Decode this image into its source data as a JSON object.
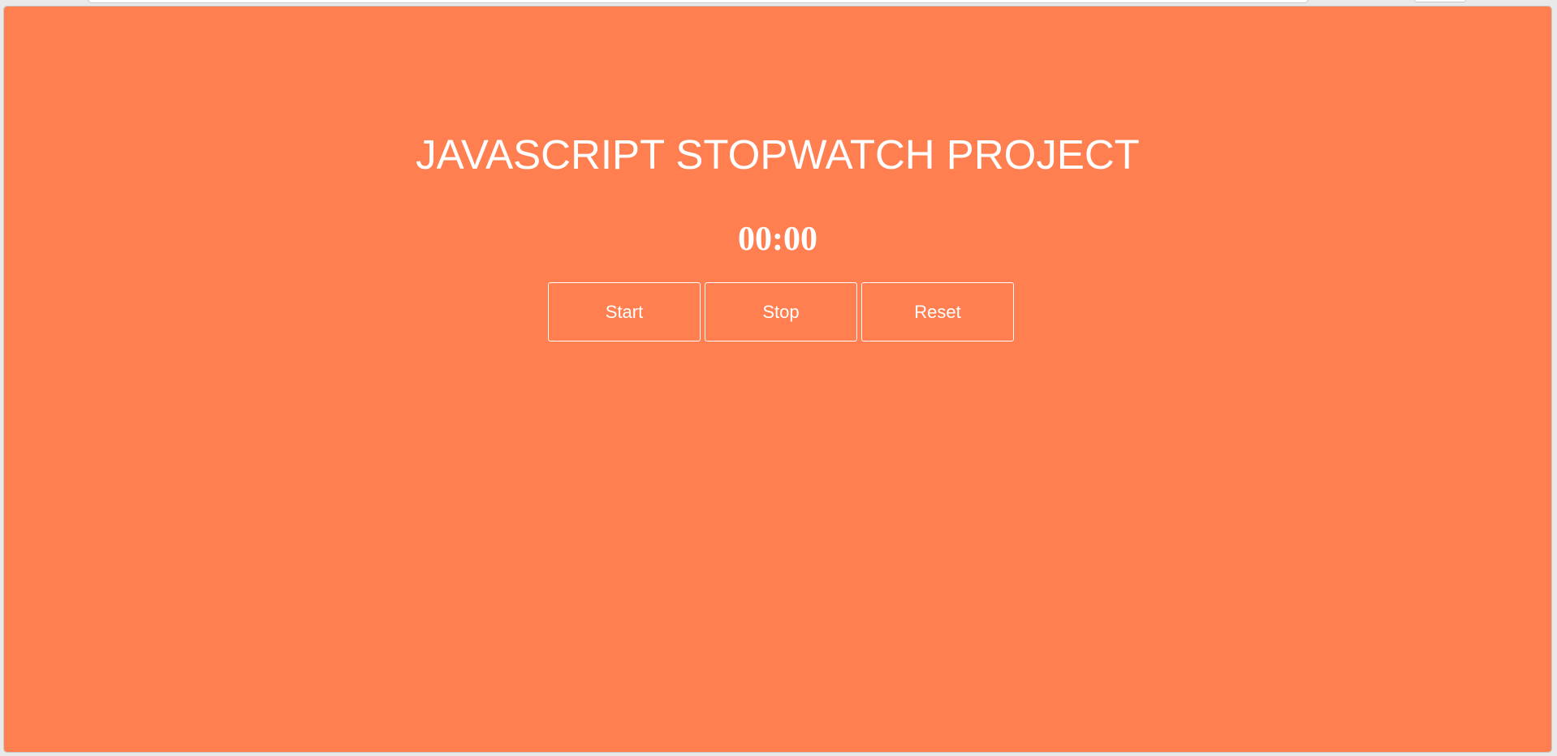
{
  "page": {
    "title": "JAVASCRIPT STOPWATCH PROJECT",
    "timer_display": "00:00",
    "background_color": "#ff7f50",
    "text_color": "#ffffff"
  },
  "controls": {
    "buttons": [
      {
        "label": "Start"
      },
      {
        "label": "Stop"
      },
      {
        "label": "Reset"
      }
    ]
  }
}
